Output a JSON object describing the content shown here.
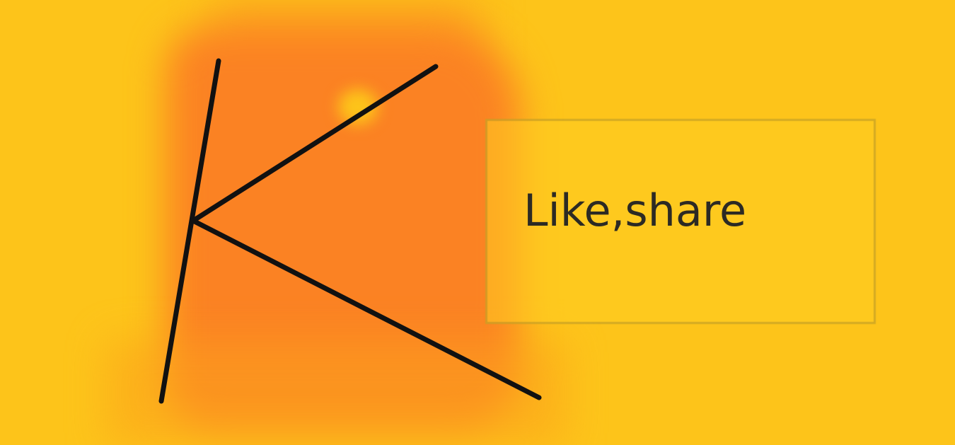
{
  "panel": {
    "text": "Like,share"
  },
  "colors": {
    "background": "#fdc41a",
    "blob": "#fb8223",
    "stroke": "#111111",
    "text": "#2c2a24"
  },
  "icons": {
    "letter_mark": "k-stroke-icon"
  }
}
